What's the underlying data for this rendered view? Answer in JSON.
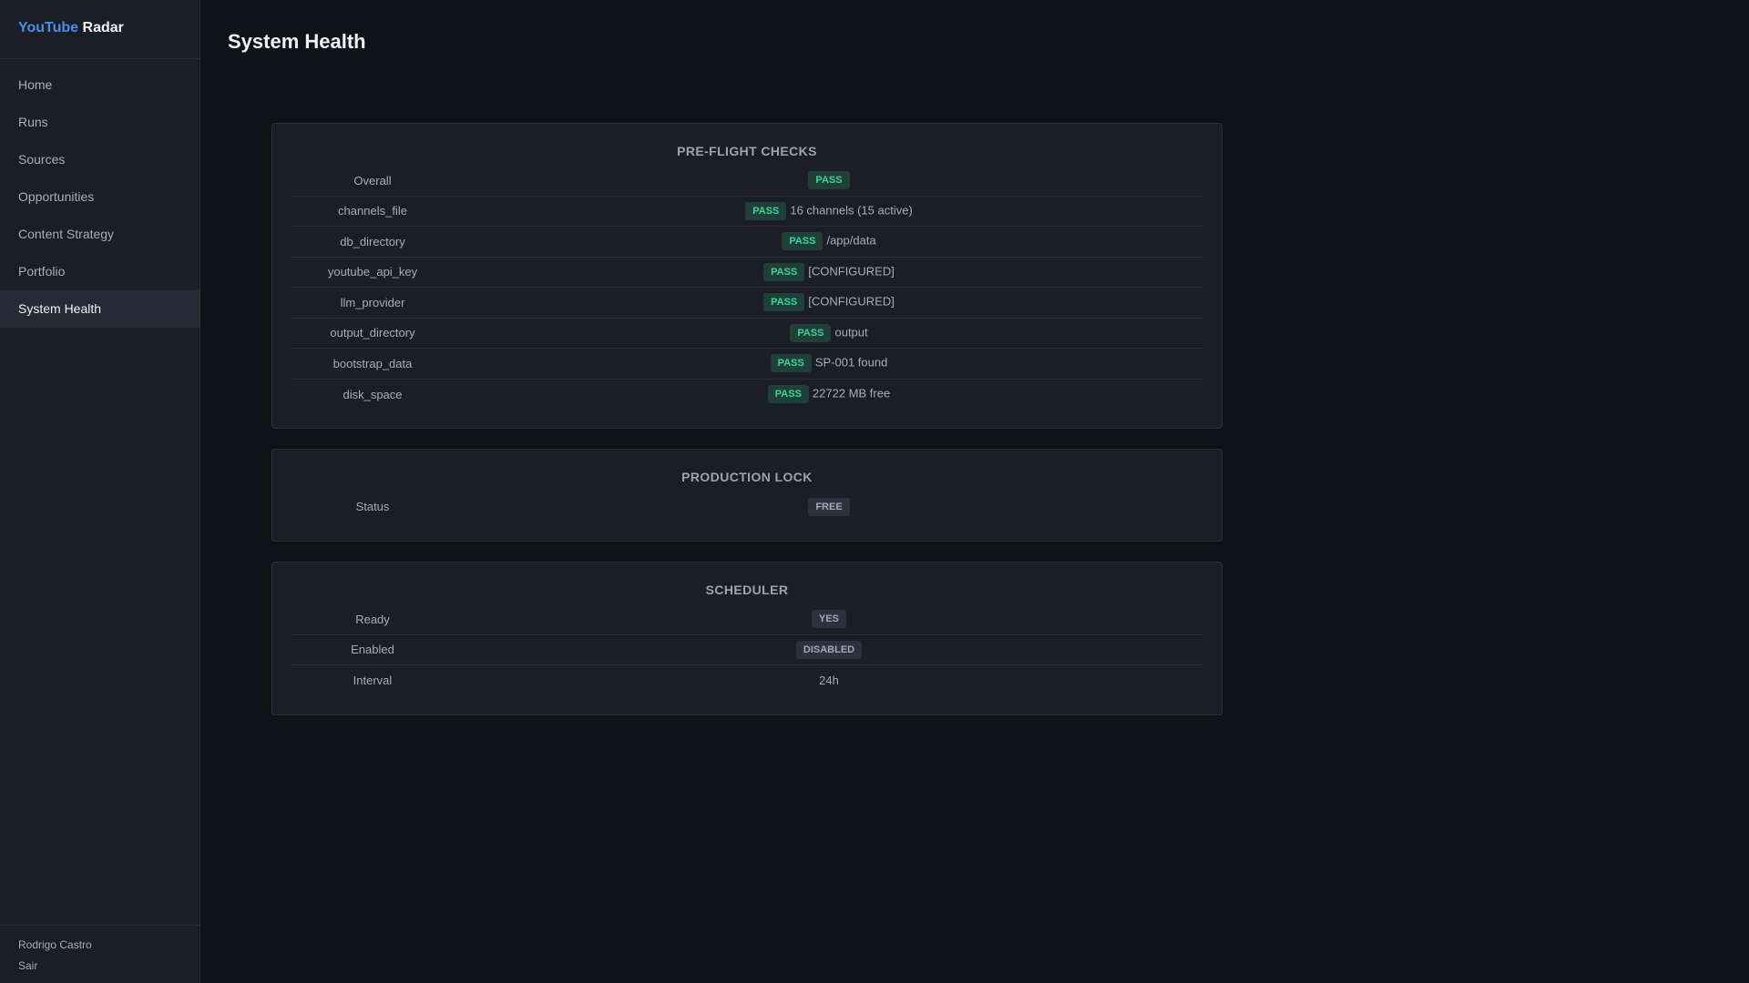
{
  "brand": {
    "part1": "YouTube",
    "part2": "Radar"
  },
  "sidebar": {
    "items": [
      {
        "label": "Home"
      },
      {
        "label": "Runs"
      },
      {
        "label": "Sources"
      },
      {
        "label": "Opportunities"
      },
      {
        "label": "Content Strategy"
      },
      {
        "label": "Portfolio"
      },
      {
        "label": "System Health"
      }
    ],
    "user": "Rodrigo Castro",
    "logout": "Sair"
  },
  "page": {
    "title": "System Health"
  },
  "preflight": {
    "title": "PRE-FLIGHT CHECKS",
    "rows": [
      {
        "label": "Overall",
        "badge": "PASS",
        "detail": ""
      },
      {
        "label": "channels_file",
        "badge": "PASS",
        "detail": "16 channels (15 active)"
      },
      {
        "label": "db_directory",
        "badge": "PASS",
        "detail": "/app/data"
      },
      {
        "label": "youtube_api_key",
        "badge": "PASS",
        "detail": "[CONFIGURED]"
      },
      {
        "label": "llm_provider",
        "badge": "PASS",
        "detail": "[CONFIGURED]"
      },
      {
        "label": "output_directory",
        "badge": "PASS",
        "detail": "output"
      },
      {
        "label": "bootstrap_data",
        "badge": "PASS",
        "detail": "SP-001 found"
      },
      {
        "label": "disk_space",
        "badge": "PASS",
        "detail": "22722 MB free"
      }
    ]
  },
  "production_lock": {
    "title": "PRODUCTION LOCK",
    "status_label": "Status",
    "status_value": "FREE"
  },
  "scheduler": {
    "title": "SCHEDULER",
    "ready_label": "Ready",
    "ready_value": "YES",
    "enabled_label": "Enabled",
    "enabled_value": "DISABLED",
    "interval_label": "Interval",
    "interval_value": "24h"
  },
  "colors": {
    "accent": "#4a90e2",
    "pass_bg": "#1f3f38",
    "pass_fg": "#3fd39a",
    "neutral_bg": "#2e313d"
  }
}
